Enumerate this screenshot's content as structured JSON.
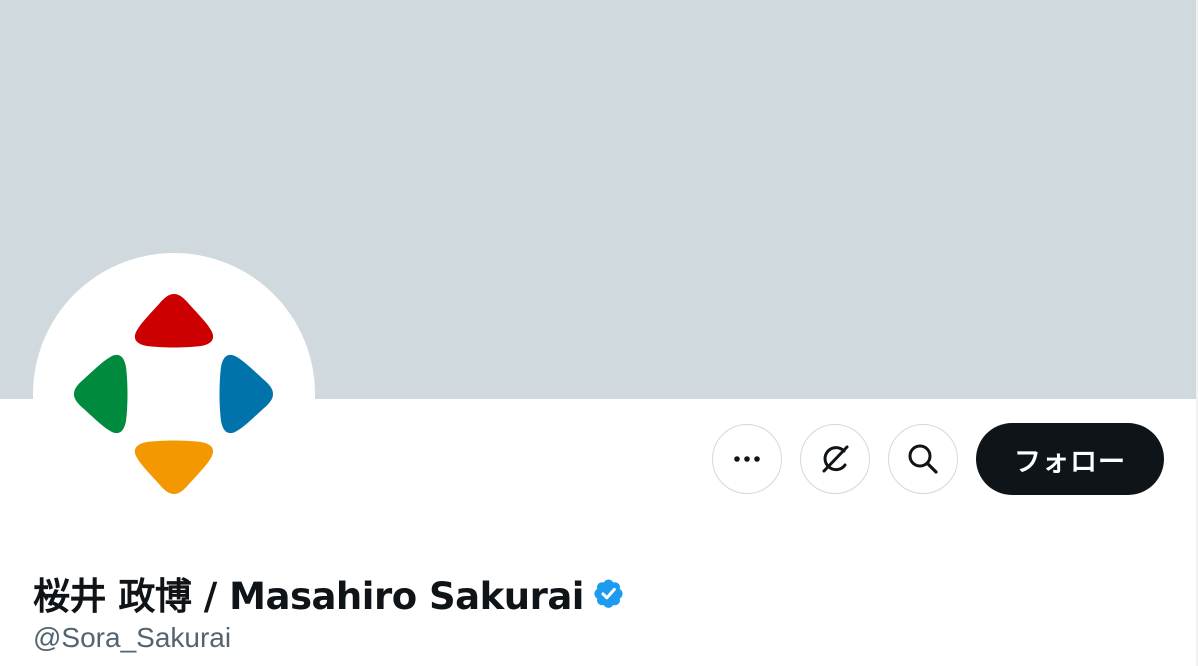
{
  "profile": {
    "display_name": "桜井 政博 / Masahiro Sakurai",
    "handle": "@Sora_Sakurai",
    "verified": true
  },
  "actions": {
    "more_icon": "ellipsis-icon",
    "grok_icon": "grok-icon",
    "search_icon": "search-icon",
    "follow_label": "フォロー"
  },
  "colors": {
    "banner": "#cfd9de",
    "follow_button_bg": "#0f1419",
    "verified": "#1d9bf0",
    "logo_red": "#cc0000",
    "logo_green": "#008a3e",
    "logo_blue": "#0073aa",
    "logo_orange": "#f39800"
  }
}
